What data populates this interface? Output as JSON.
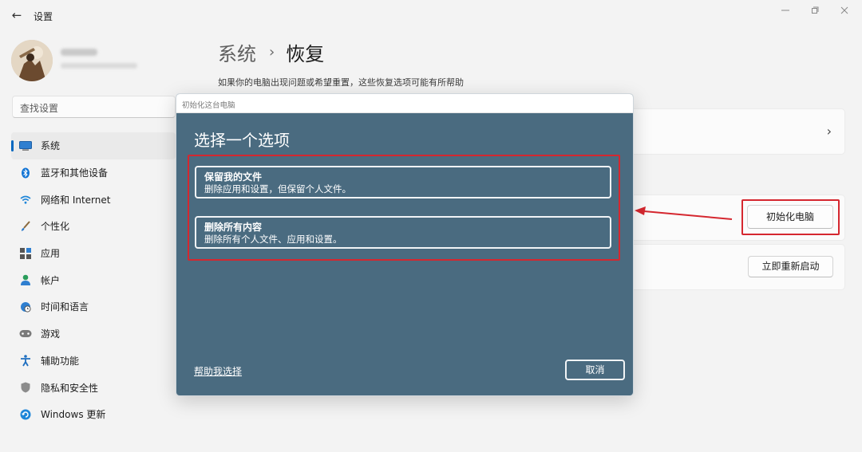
{
  "app": {
    "title": "设置"
  },
  "search": {
    "placeholder": "查找设置"
  },
  "sidebar": {
    "items": [
      {
        "label": "系统",
        "icon": "system-icon",
        "active": true
      },
      {
        "label": "蓝牙和其他设备",
        "icon": "bluetooth-icon"
      },
      {
        "label": "网络和 Internet",
        "icon": "wifi-icon"
      },
      {
        "label": "个性化",
        "icon": "brush-icon"
      },
      {
        "label": "应用",
        "icon": "apps-icon"
      },
      {
        "label": "帐户",
        "icon": "account-icon"
      },
      {
        "label": "时间和语言",
        "icon": "globe-clock-icon"
      },
      {
        "label": "游戏",
        "icon": "gamepad-icon"
      },
      {
        "label": "辅助功能",
        "icon": "accessibility-icon"
      },
      {
        "label": "隐私和安全性",
        "icon": "shield-icon"
      },
      {
        "label": "Windows 更新",
        "icon": "update-icon"
      }
    ]
  },
  "main": {
    "breadcrumb": {
      "parent": "系统",
      "separator": "›",
      "current": "恢复"
    },
    "subtitle": "如果你的电脑出现问题或希望重置，这些恢复选项可能有所帮助",
    "reset_button": "初始化电脑",
    "restart_button": "立即重新启动"
  },
  "dialog": {
    "window_title": "初始化这台电脑",
    "heading": "选择一个选项",
    "options": [
      {
        "title": "保留我的文件",
        "description": "删除应用和设置，但保留个人文件。"
      },
      {
        "title": "删除所有内容",
        "description": "删除所有个人文件、应用和设置。"
      }
    ],
    "help_link": "帮助我选择",
    "cancel": "取消"
  },
  "colors": {
    "accent": "#0067c0",
    "dialog_bg": "#4a6b80",
    "annotation_red": "#d5272f"
  }
}
